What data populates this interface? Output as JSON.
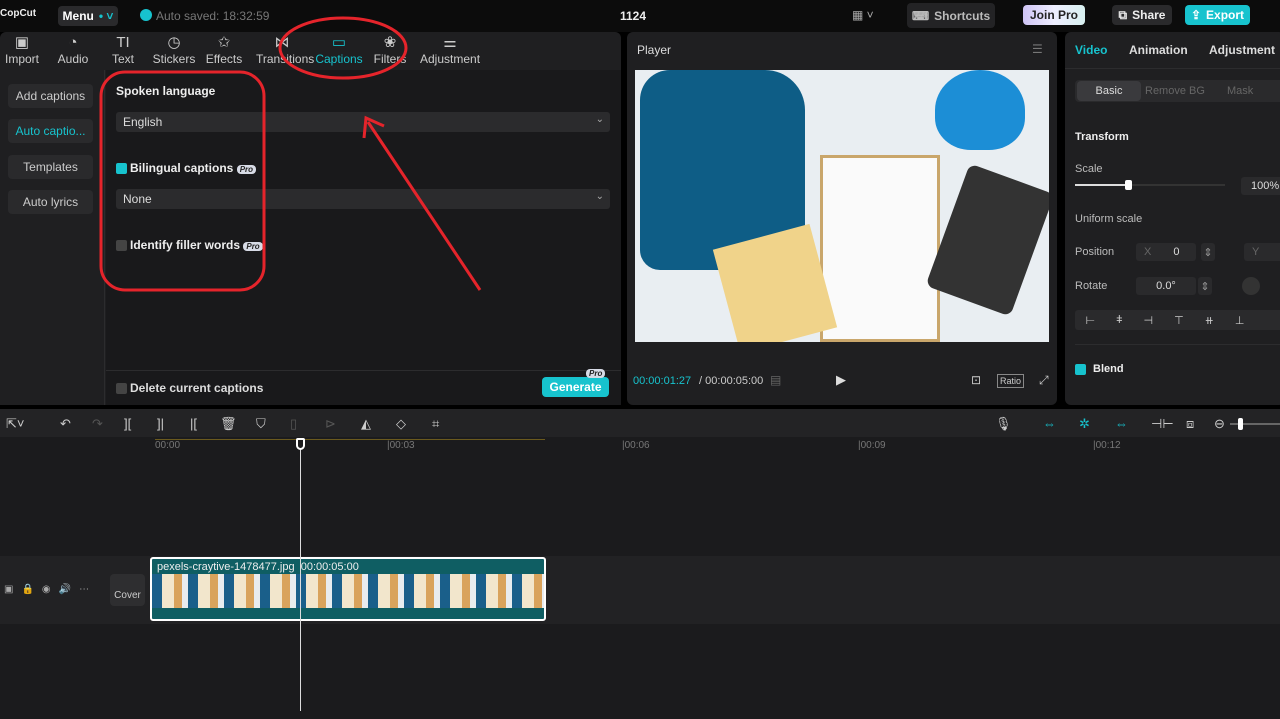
{
  "app": {
    "logo": "CopCut",
    "menu": "Menu",
    "autosave": "Auto saved: 18:32:59",
    "project_title": "1124"
  },
  "topbar": {
    "shortcuts": "Shortcuts",
    "join_pro": "Join Pro",
    "share": "Share",
    "export": "Export",
    "accent": "#17c3ce"
  },
  "tabs": [
    {
      "label": "Import",
      "icon": "import-icon"
    },
    {
      "label": "Audio",
      "icon": "audio-icon"
    },
    {
      "label": "Text",
      "icon": "text-icon"
    },
    {
      "label": "Stickers",
      "icon": "stickers-icon"
    },
    {
      "label": "Effects",
      "icon": "effects-icon"
    },
    {
      "label": "Transitions",
      "icon": "transitions-icon"
    },
    {
      "label": "Captions",
      "icon": "captions-icon",
      "active": true
    },
    {
      "label": "Filters",
      "icon": "filters-icon"
    },
    {
      "label": "Adjustment",
      "icon": "adjustment-icon"
    }
  ],
  "caption_menu": [
    "Add captions",
    "Auto captio...",
    "Templates",
    "Auto lyrics"
  ],
  "captions": {
    "spoken_language_label": "Spoken language",
    "spoken_language": "English",
    "bilingual_label": "Bilingual captions",
    "bilingual_checked": true,
    "bilingual_value": "None",
    "filler_label": "Identify filler words",
    "filler_checked": false,
    "pro_badge": "Pro",
    "delete_label": "Delete current captions",
    "generate": "Generate"
  },
  "player": {
    "title": "Player",
    "current_time": "00:00:01:27",
    "duration": "00:00:05:00",
    "ratio": "Ratio"
  },
  "inspector": {
    "tabs": [
      "Video",
      "Animation",
      "Adjustment"
    ],
    "subtabs": [
      "Basic",
      "Remove BG",
      "Mask"
    ],
    "transform": "Transform",
    "scale_label": "Scale",
    "scale_value": "100%",
    "scale_fraction": 0.35,
    "uniform_scale": "Uniform scale",
    "position_label": "Position",
    "x_label": "X",
    "x_value": "0",
    "y_label": "Y",
    "rotate_label": "Rotate",
    "rotate_value": "0.0°",
    "blend": "Blend"
  },
  "timeline": {
    "ticks": [
      "00:00",
      "|00:03",
      "|00:06",
      "|00:09",
      "|00:12"
    ],
    "clip_name": "pexels-craytive-1478477.jpg",
    "clip_duration": "00:00:05:00",
    "cover": "Cover",
    "clip_color": "#0f5e63"
  }
}
